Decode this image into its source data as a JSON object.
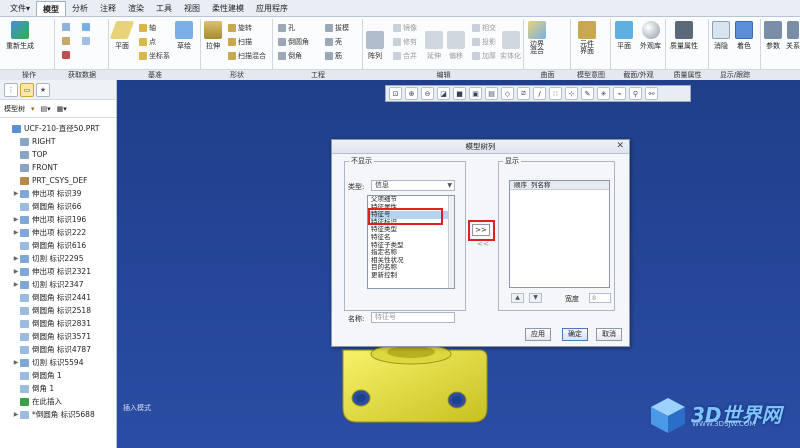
{
  "menu": {
    "tabs": [
      "文件",
      "模型",
      "分析",
      "注释",
      "渲染",
      "工具",
      "视图",
      "柔性建模",
      "应用程序"
    ],
    "file_arrow": "▾"
  },
  "ribbon": {
    "tools": {
      "regenerate": "重新生成",
      "plane": "平面",
      "sketch": "草绘",
      "extrude": "拉伸",
      "array": "阵列",
      "boundary_blend": "边界\n混合",
      "component_interface": "元件\n界面",
      "section_plane": "平面",
      "appearance": "外观库",
      "mass_props": "质量属性",
      "hidden": "消隐",
      "color": "着色",
      "params": "参数",
      "relations": "关系"
    },
    "small": {
      "axis": "轴",
      "point": "点",
      "csys": "坐标系",
      "revolve": "旋转",
      "sweep": "扫描",
      "swept_blend": "扫描混合",
      "hole": "孔",
      "round": "倒圆角",
      "chamfer": "倒角",
      "draft": "拔模",
      "shell": "壳",
      "rib": "筋",
      "mirror": "镜像",
      "trim": "修剪",
      "merge": "合并",
      "extend": "延伸",
      "offset": "偏移",
      "intersect": "相交",
      "project": "投影",
      "thicken": "加厚",
      "solidify": "实体化"
    },
    "groups": [
      "操作",
      "获取数据",
      "基准",
      "形状",
      "工程",
      "编辑",
      "曲面",
      "模型意图",
      "截面/外观",
      "质量属性",
      "显示/跟踪"
    ]
  },
  "left_panel": {
    "toolbar_label": "模型树",
    "tree": [
      {
        "label": "UCF-210-直径50.PRT",
        "exp": "",
        "color": "#5b8fd6"
      },
      {
        "label": "RIGHT",
        "exp": "",
        "color": "#8aa4c4"
      },
      {
        "label": "TOP",
        "exp": "",
        "color": "#8aa4c4"
      },
      {
        "label": "FRONT",
        "exp": "",
        "color": "#8aa4c4"
      },
      {
        "label": "PRT_CSYS_DEF",
        "exp": "",
        "color": "#b88a4a"
      },
      {
        "label": "伸出项 标识39",
        "exp": "▶",
        "color": "#7fa7d8"
      },
      {
        "label": "倒圆角 标识66",
        "exp": "",
        "color": "#9bbbe0"
      },
      {
        "label": "伸出项 标识196",
        "exp": "▶",
        "color": "#7fa7d8"
      },
      {
        "label": "伸出项 标识222",
        "exp": "▶",
        "color": "#7fa7d8"
      },
      {
        "label": "倒圆角 标识616",
        "exp": "",
        "color": "#9bbbe0"
      },
      {
        "label": "切割 标识2295",
        "exp": "▶",
        "color": "#7fa7d8"
      },
      {
        "label": "伸出项 标识2321",
        "exp": "▶",
        "color": "#7fa7d8"
      },
      {
        "label": "切割 标识2347",
        "exp": "▶",
        "color": "#7fa7d8"
      },
      {
        "label": "倒圆角 标识2441",
        "exp": "",
        "color": "#9bbbe0"
      },
      {
        "label": "倒圆角 标识2518",
        "exp": "",
        "color": "#9bbbe0"
      },
      {
        "label": "倒圆角 标识2831",
        "exp": "",
        "color": "#9bbbe0"
      },
      {
        "label": "倒圆角 标识3571",
        "exp": "",
        "color": "#9bbbe0"
      },
      {
        "label": "倒圆角 标识4787",
        "exp": "",
        "color": "#9bbbe0"
      },
      {
        "label": "切割 标识5594",
        "exp": "▶",
        "color": "#7fa7d8"
      },
      {
        "label": "倒圆角 1",
        "exp": "",
        "color": "#9bbbe0"
      },
      {
        "label": "倒角 1",
        "exp": "",
        "color": "#9bbbe0"
      },
      {
        "label": "在此插入",
        "exp": "",
        "color": "#3aa04a"
      },
      {
        "label": "*倒圆角 标识5688",
        "exp": "▶",
        "color": "#9bbbe0"
      }
    ]
  },
  "viewport": {
    "status": "插入模式"
  },
  "watermark": {
    "text": "3D世界网",
    "url": "WWW.3DSJW.COM"
  },
  "dialog": {
    "title": "模型树列",
    "close": "✕",
    "left_label": "不显示",
    "right_label": "显示",
    "type_label": "类型:",
    "type_value": "信息",
    "list": [
      "父项细节",
      "特征属性",
      "特征号",
      "特征标识",
      "特征类型",
      "特征名",
      "特征子类型",
      "指定名称",
      "相关性状况",
      "目的名称",
      "更新控制"
    ],
    "selected_index": 2,
    "name_label": "名称:",
    "name_placeholder": "特征号",
    "add_button": ">>",
    "remove_button": "<<",
    "col_order": "顺序",
    "col_name": "列名称",
    "width_label": "宽度",
    "width_value": "8",
    "up": "▲",
    "down": "▼",
    "apply": "应用",
    "ok": "确定",
    "cancel": "取消"
  }
}
